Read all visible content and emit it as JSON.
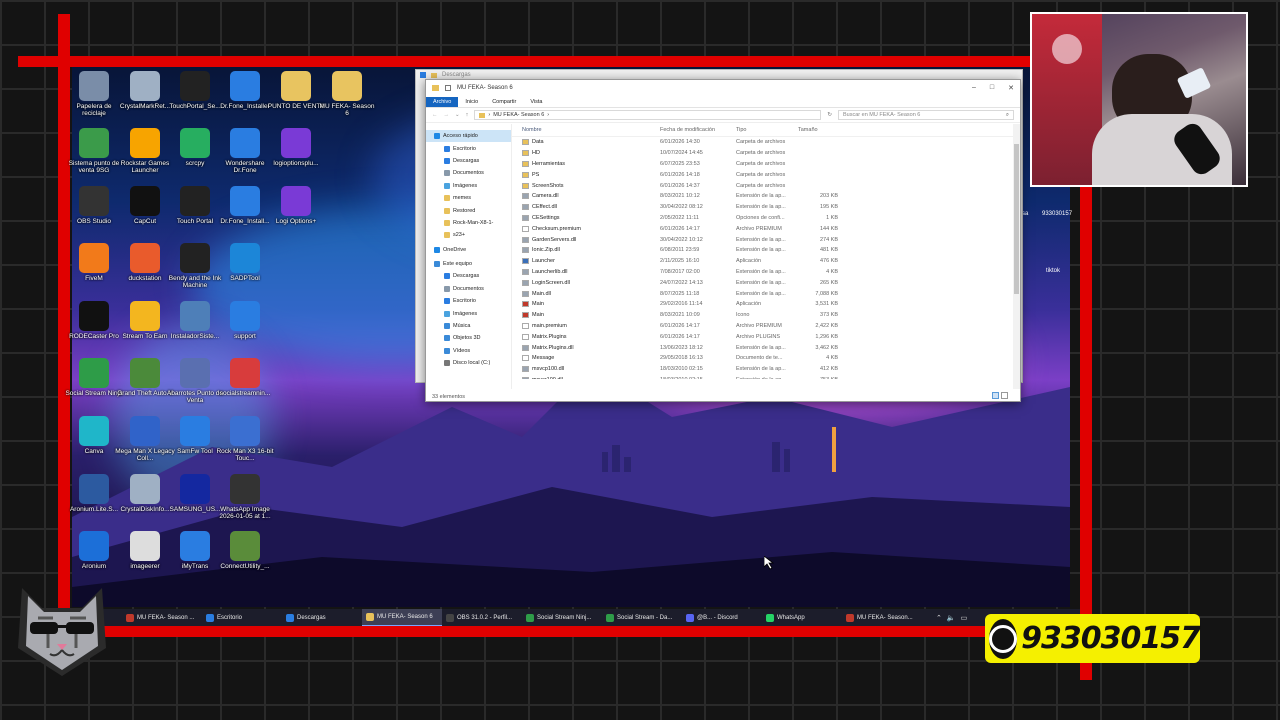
{
  "desktop_icons": [
    {
      "label": "Papelera de reciclaje",
      "color": "#7a8da8"
    },
    {
      "label": "CrystalMarkRet...",
      "color": "#9fb0c4"
    },
    {
      "label": "TouchPortal_Se...",
      "color": "#222222"
    },
    {
      "label": "Dr.Fone_Installer",
      "color": "#2a7de1"
    },
    {
      "label": "PUNTO DE VENTA",
      "color": "#e8c460"
    },
    {
      "label": "MU FEKA- Season 6",
      "color": "#e8c460"
    },
    {
      "label": "Sistema punto de venta 9SG",
      "color": "#3b9b4a"
    },
    {
      "label": "Rockstar Games Launcher",
      "color": "#f7a400"
    },
    {
      "label": "scrcpy",
      "color": "#27ae60"
    },
    {
      "label": "Wondershare Dr.Fone",
      "color": "#2a7de1"
    },
    {
      "label": "logioptionsplu...",
      "color": "#7a3ad6"
    },
    {
      "label": "OBS Studio",
      "color": "#333333"
    },
    {
      "label": "CapCut",
      "color": "#111111"
    },
    {
      "label": "Touch Portal",
      "color": "#222222"
    },
    {
      "label": "Dr.Fone_Install...",
      "color": "#2a7de1"
    },
    {
      "label": "Logi Options+",
      "color": "#7a3ad6"
    },
    {
      "label": "FiveM",
      "color": "#f27a1a"
    },
    {
      "label": "duckstation",
      "color": "#e95b2c"
    },
    {
      "label": "Bendy and the Ink Machine",
      "color": "#222222"
    },
    {
      "label": "SADPTool",
      "color": "#1c86d8"
    },
    {
      "label": "RODECaster Pro",
      "color": "#111111"
    },
    {
      "label": "Stream To Earn",
      "color": "#f3b61f"
    },
    {
      "label": "InstaladorSiste...",
      "color": "#4e7fb8"
    },
    {
      "label": "support",
      "color": "#2a7de1"
    },
    {
      "label": "Social Stream Ninja",
      "color": "#2e9c48"
    },
    {
      "label": "Grand Theft Auto V",
      "color": "#4b8a3a"
    },
    {
      "label": "Abarrotes Punto de Venta",
      "color": "#5a6fb0"
    },
    {
      "label": "socialstreamnin...",
      "color": "#d83c3c"
    },
    {
      "label": "Canva",
      "color": "#1fb6c9"
    },
    {
      "label": "Mega Man X Legacy Coll...",
      "color": "#3063c9"
    },
    {
      "label": "SamFw Tool",
      "color": "#2a7de1"
    },
    {
      "label": "Rock Man X3 16-bit Touc...",
      "color": "#3b6fd1"
    },
    {
      "label": "Aronium.Lite.S...",
      "color": "#2c5aa0"
    },
    {
      "label": "CrystalDiskInfo...",
      "color": "#9fb0c4"
    },
    {
      "label": "SAMSUNG_US...",
      "color": "#1428a0"
    },
    {
      "label": "WhatsApp Image 2026-01-05 at 1...",
      "color": "#333333"
    },
    {
      "label": "Aronium",
      "color": "#1c6fd8"
    },
    {
      "label": "imageerer",
      "color": "#dddddd"
    },
    {
      "label": "iMyTrans",
      "color": "#2a7de1"
    },
    {
      "label": "ConnectUtility_...",
      "color": "#5a8c3a"
    }
  ],
  "right_edge_labels": [
    "sa",
    "933030157",
    "tiktok"
  ],
  "explorer_back": {
    "title": "Descargas"
  },
  "explorer": {
    "title": "MU FEKA- Season 6",
    "ribbon": [
      "Archivo",
      "Inicio",
      "Compartir",
      "Vista"
    ],
    "address": "MU FEKA- Season 6",
    "search_placeholder": "Buscar en MU FEKA- Season 6",
    "columns": [
      "Nombre",
      "Fecha de modificación",
      "Tipo",
      "Tamaño"
    ],
    "status": "33 elementos",
    "nav": [
      {
        "label": "Acceso rápido",
        "icon": "star-icon",
        "color": "#1e88e5",
        "group": true,
        "selected": true
      },
      {
        "label": "Escritorio",
        "icon": "desktop-icon",
        "color": "#2a7de1"
      },
      {
        "label": "Descargas",
        "icon": "download-icon",
        "color": "#2a7de1"
      },
      {
        "label": "Documentos",
        "icon": "document-icon",
        "color": "#8899aa"
      },
      {
        "label": "Imágenes",
        "icon": "image-icon",
        "color": "#4aa3df"
      },
      {
        "label": "memes",
        "icon": "folder-icon",
        "color": "#e8c15a"
      },
      {
        "label": "Restored",
        "icon": "folder-icon",
        "color": "#e8c15a"
      },
      {
        "label": "Rock-Man-X8-1-",
        "icon": "folder-icon",
        "color": "#e8c15a"
      },
      {
        "label": "s23+",
        "icon": "folder-icon",
        "color": "#e8c15a"
      },
      {
        "label": "OneDrive",
        "icon": "cloud-icon",
        "color": "#1e88e5",
        "group": true
      },
      {
        "label": "Este equipo",
        "icon": "computer-icon",
        "color": "#3a8ad8",
        "group": true
      },
      {
        "label": "Descargas",
        "icon": "download-icon",
        "color": "#2a7de1"
      },
      {
        "label": "Documentos",
        "icon": "document-icon",
        "color": "#8899aa"
      },
      {
        "label": "Escritorio",
        "icon": "desktop-icon",
        "color": "#2a7de1"
      },
      {
        "label": "Imágenes",
        "icon": "image-icon",
        "color": "#4aa3df"
      },
      {
        "label": "Música",
        "icon": "music-icon",
        "color": "#3a8ad8"
      },
      {
        "label": "Objetos 3D",
        "icon": "cube-icon",
        "color": "#3a8ad8"
      },
      {
        "label": "Vídeos",
        "icon": "video-icon",
        "color": "#3a8ad8"
      },
      {
        "label": "Disco local (C:)",
        "icon": "drive-icon",
        "color": "#777777"
      }
    ],
    "files": [
      {
        "name": "Data",
        "date": "6/01/2026 14:30",
        "type": "Carpeta de archivos",
        "size": "",
        "color": "#e8c15a"
      },
      {
        "name": "HD",
        "date": "10/07/2024 14:45",
        "type": "Carpeta de archivos",
        "size": "",
        "color": "#e8c15a"
      },
      {
        "name": "Herramientas",
        "date": "6/07/2025 23:53",
        "type": "Carpeta de archivos",
        "size": "",
        "color": "#e8c15a"
      },
      {
        "name": "PS",
        "date": "6/01/2026 14:18",
        "type": "Carpeta de archivos",
        "size": "",
        "color": "#e8c15a"
      },
      {
        "name": "ScreenShots",
        "date": "6/01/2026 14:37",
        "type": "Carpeta de archivos",
        "size": "",
        "color": "#e8c15a"
      },
      {
        "name": "Camera.dll",
        "date": "8/03/2021 10:12",
        "type": "Extensión de la ap...",
        "size": "203 KB",
        "color": "#9aa4b0"
      },
      {
        "name": "CEffect.dll",
        "date": "30/04/2022 08:12",
        "type": "Extensión de la ap...",
        "size": "195 KB",
        "color": "#9aa4b0"
      },
      {
        "name": "CESettings",
        "date": "2/05/2022 11:11",
        "type": "Opciones de confi...",
        "size": "1 KB",
        "color": "#9aa4b0"
      },
      {
        "name": "Checksum.premium",
        "date": "6/01/2026 14:17",
        "type": "Archivo PREMIUM",
        "size": "144 KB",
        "color": "#ffffff"
      },
      {
        "name": "GardenServers.dll",
        "date": "30/04/2022 10:12",
        "type": "Extensión de la ap...",
        "size": "274 KB",
        "color": "#9aa4b0"
      },
      {
        "name": "Ionic.Zip.dll",
        "date": "6/08/2011 23:59",
        "type": "Extensión de la ap...",
        "size": "481 KB",
        "color": "#9aa4b0"
      },
      {
        "name": "Launcher",
        "date": "2/11/2025 16:10",
        "type": "Aplicación",
        "size": "476 KB",
        "color": "#3a6fb8"
      },
      {
        "name": "Launcherlib.dll",
        "date": "7/08/2017 02:00",
        "type": "Extensión de la ap...",
        "size": "4 KB",
        "color": "#9aa4b0"
      },
      {
        "name": "LoginScreen.dll",
        "date": "24/07/2022 14:13",
        "type": "Extensión de la ap...",
        "size": "265 KB",
        "color": "#9aa4b0"
      },
      {
        "name": "Main.dll",
        "date": "8/07/2025 11:18",
        "type": "Extensión de la ap...",
        "size": "7,088 KB",
        "color": "#9aa4b0"
      },
      {
        "name": "Main",
        "date": "29/02/2016 11:14",
        "type": "Aplicación",
        "size": "3,531 KB",
        "color": "#c0392b"
      },
      {
        "name": "Main",
        "date": "8/03/2021 10:09",
        "type": "Icono",
        "size": "373 KB",
        "color": "#c0392b"
      },
      {
        "name": "main.premium",
        "date": "6/01/2026 14:17",
        "type": "Archivo PREMIUM",
        "size": "2,422 KB",
        "color": "#ffffff"
      },
      {
        "name": "Matrix.Plugins",
        "date": "6/01/2026 14:17",
        "type": "Archivo PLUGINS",
        "size": "1,296 KB",
        "color": "#ffffff"
      },
      {
        "name": "Matrix.Plugins.dll",
        "date": "13/06/2023 18:12",
        "type": "Extensión de la ap...",
        "size": "3,462 KB",
        "color": "#9aa4b0"
      },
      {
        "name": "Message",
        "date": "29/05/2018 16:13",
        "type": "Documento de te...",
        "size": "4 KB",
        "color": "#ffffff"
      },
      {
        "name": "msvcp100.dll",
        "date": "18/03/2010 02:15",
        "type": "Extensión de la ap...",
        "size": "412 KB",
        "color": "#9aa4b0"
      },
      {
        "name": "msvcr100.dll",
        "date": "18/03/2010 02:15",
        "type": "Extensión de la ap...",
        "size": "753 KB",
        "color": "#9aa4b0"
      }
    ]
  },
  "taskbar": [
    {
      "label": "MU FEKA- Season ...",
      "color": "#c0392b"
    },
    {
      "label": "Escritorio",
      "color": "#2a7de1"
    },
    {
      "label": "Descargas",
      "color": "#2a7de1"
    },
    {
      "label": "MU FEKA- Season 6",
      "color": "#e8c15a",
      "active": true
    },
    {
      "label": "OBS 31.0.2 - Perfil...",
      "color": "#444444"
    },
    {
      "label": "Social Stream Ninj...",
      "color": "#2e9c48"
    },
    {
      "label": "Social Stream - Da...",
      "color": "#2e9c48"
    },
    {
      "label": "@B... - Discord",
      "color": "#5865f2"
    },
    {
      "label": "WhatsApp",
      "color": "#25d366"
    },
    {
      "label": "MU FEKA- Season...",
      "color": "#c0392b"
    }
  ],
  "whatsapp_banner": {
    "number": "933030157",
    "color": "#f5f000"
  }
}
